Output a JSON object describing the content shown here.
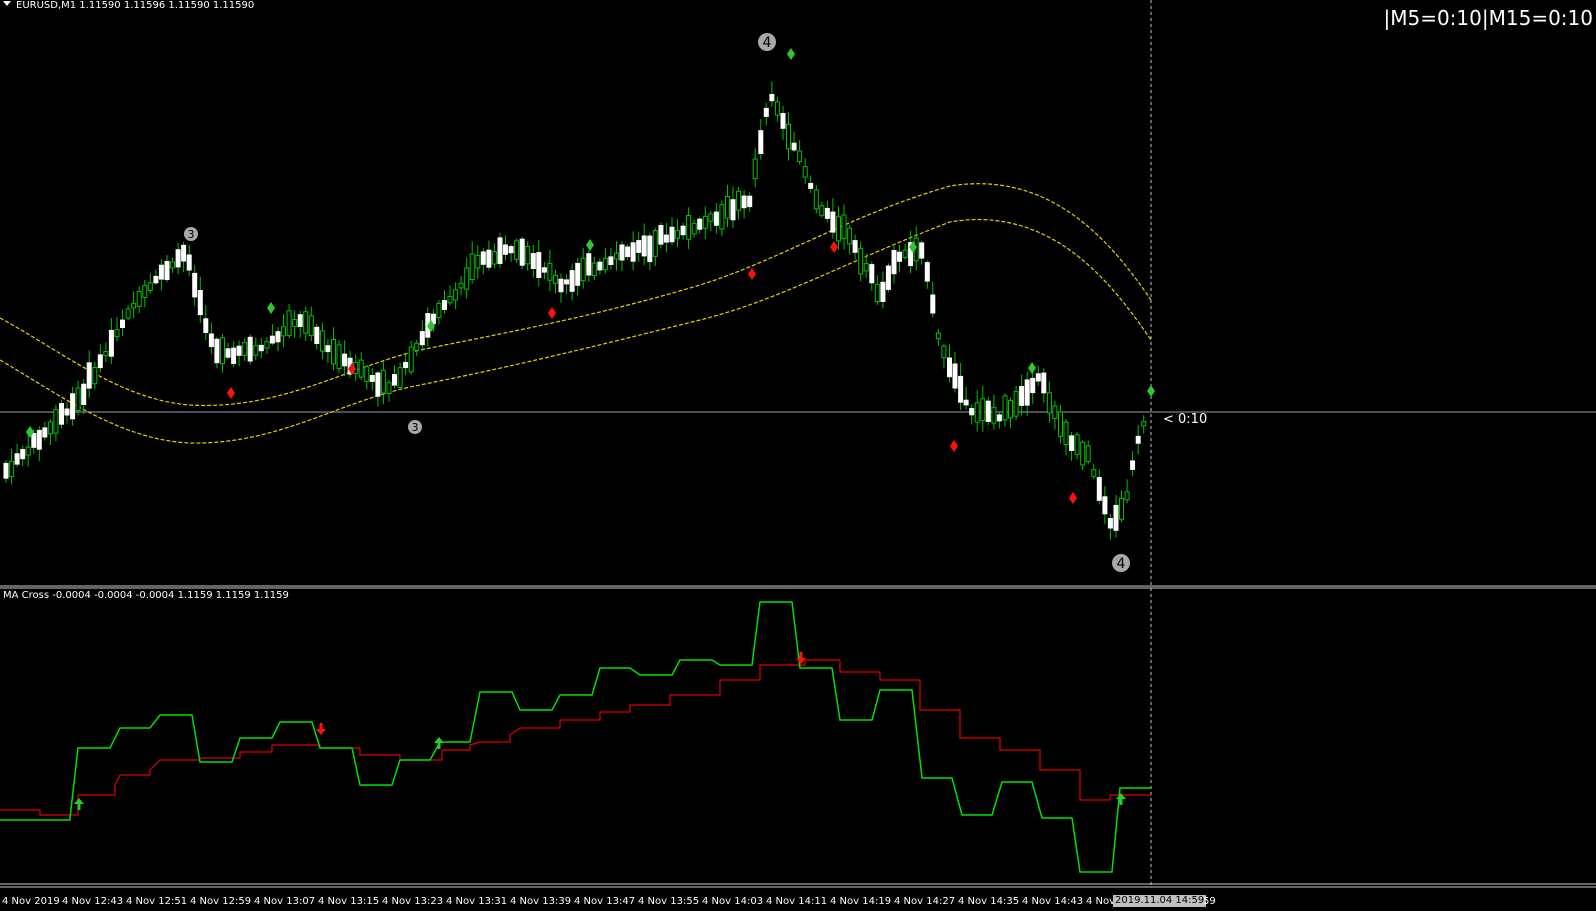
{
  "header": {
    "symbol_info": "EURUSD,M1  1.11590 1.11596 1.11590 1.11590",
    "timer_readout": "|M5=0:10|M15=0:10"
  },
  "price_line": {
    "tag": "< 0:10"
  },
  "indicator": {
    "header": "MA Cross -0.0004 -0.0004 -0.0004   1.1159 1.1159 1.1159"
  },
  "wave_labels": {
    "top": "4",
    "left_top": "3",
    "mid_bottom": "3",
    "right_bottom": "4"
  },
  "time_axis": {
    "ticks": [
      "4 Nov 2019",
      "4 Nov 12:43",
      "4 Nov 12:51",
      "4 Nov 12:59",
      "4 Nov 13:07",
      "4 Nov 13:15",
      "4 Nov 13:23",
      "4 Nov 13:31",
      "4 Nov 13:39",
      "4 Nov 13:47",
      "4 Nov 13:55",
      "4 Nov 14:03",
      "4 Nov 14:11",
      "4 Nov 14:19",
      "4 Nov 14:27",
      "4 Nov 14:35",
      "4 Nov 14:43",
      "4 Nov"
    ],
    "cursor_time": "2019.11.04 14:59",
    "trailing_fragment": "59"
  },
  "colors": {
    "background": "#000000",
    "bull_candle": "#ffffff",
    "wick": "#00c000",
    "ma_band": "#e6d200",
    "fast_ma": "#00e000",
    "slow_ma": "#e00000",
    "buy_signal": "#2ec82e",
    "sell_signal": "#ff1010",
    "wave_label_bg": "#a8a8a8"
  }
}
